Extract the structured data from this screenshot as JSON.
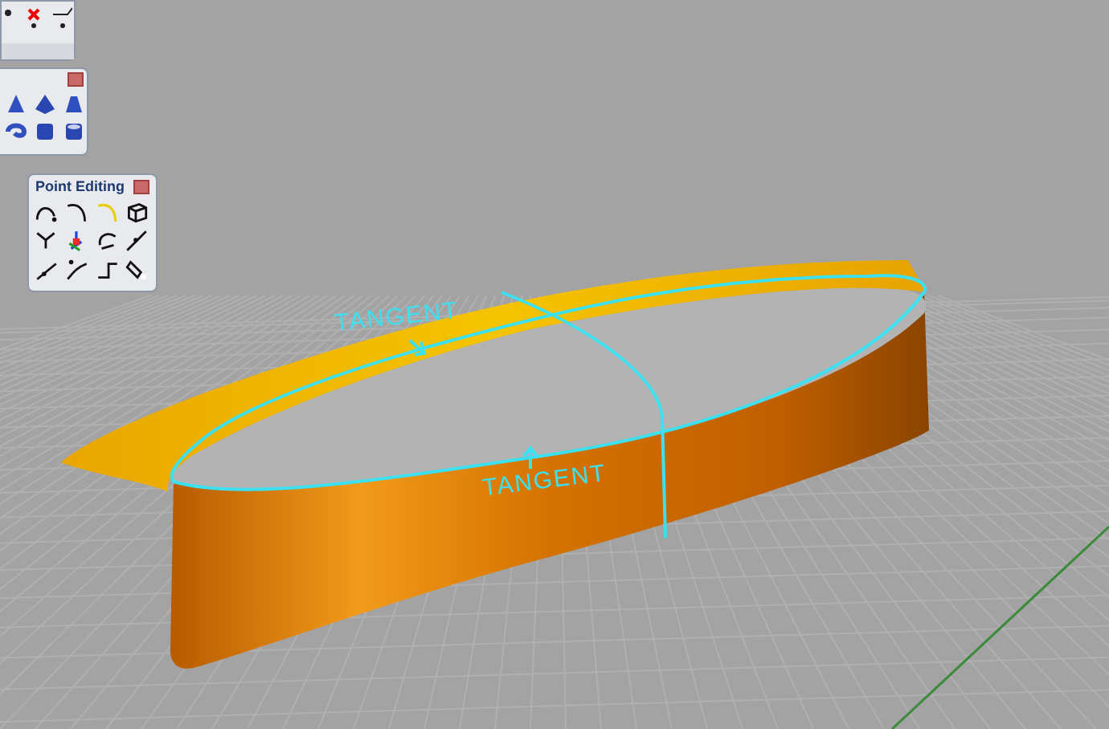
{
  "toolbars": [
    {
      "title": "Point Editing"
    }
  ],
  "annotations": [
    {
      "text": "TANGENT"
    },
    {
      "text": "TANGENT"
    }
  ]
}
